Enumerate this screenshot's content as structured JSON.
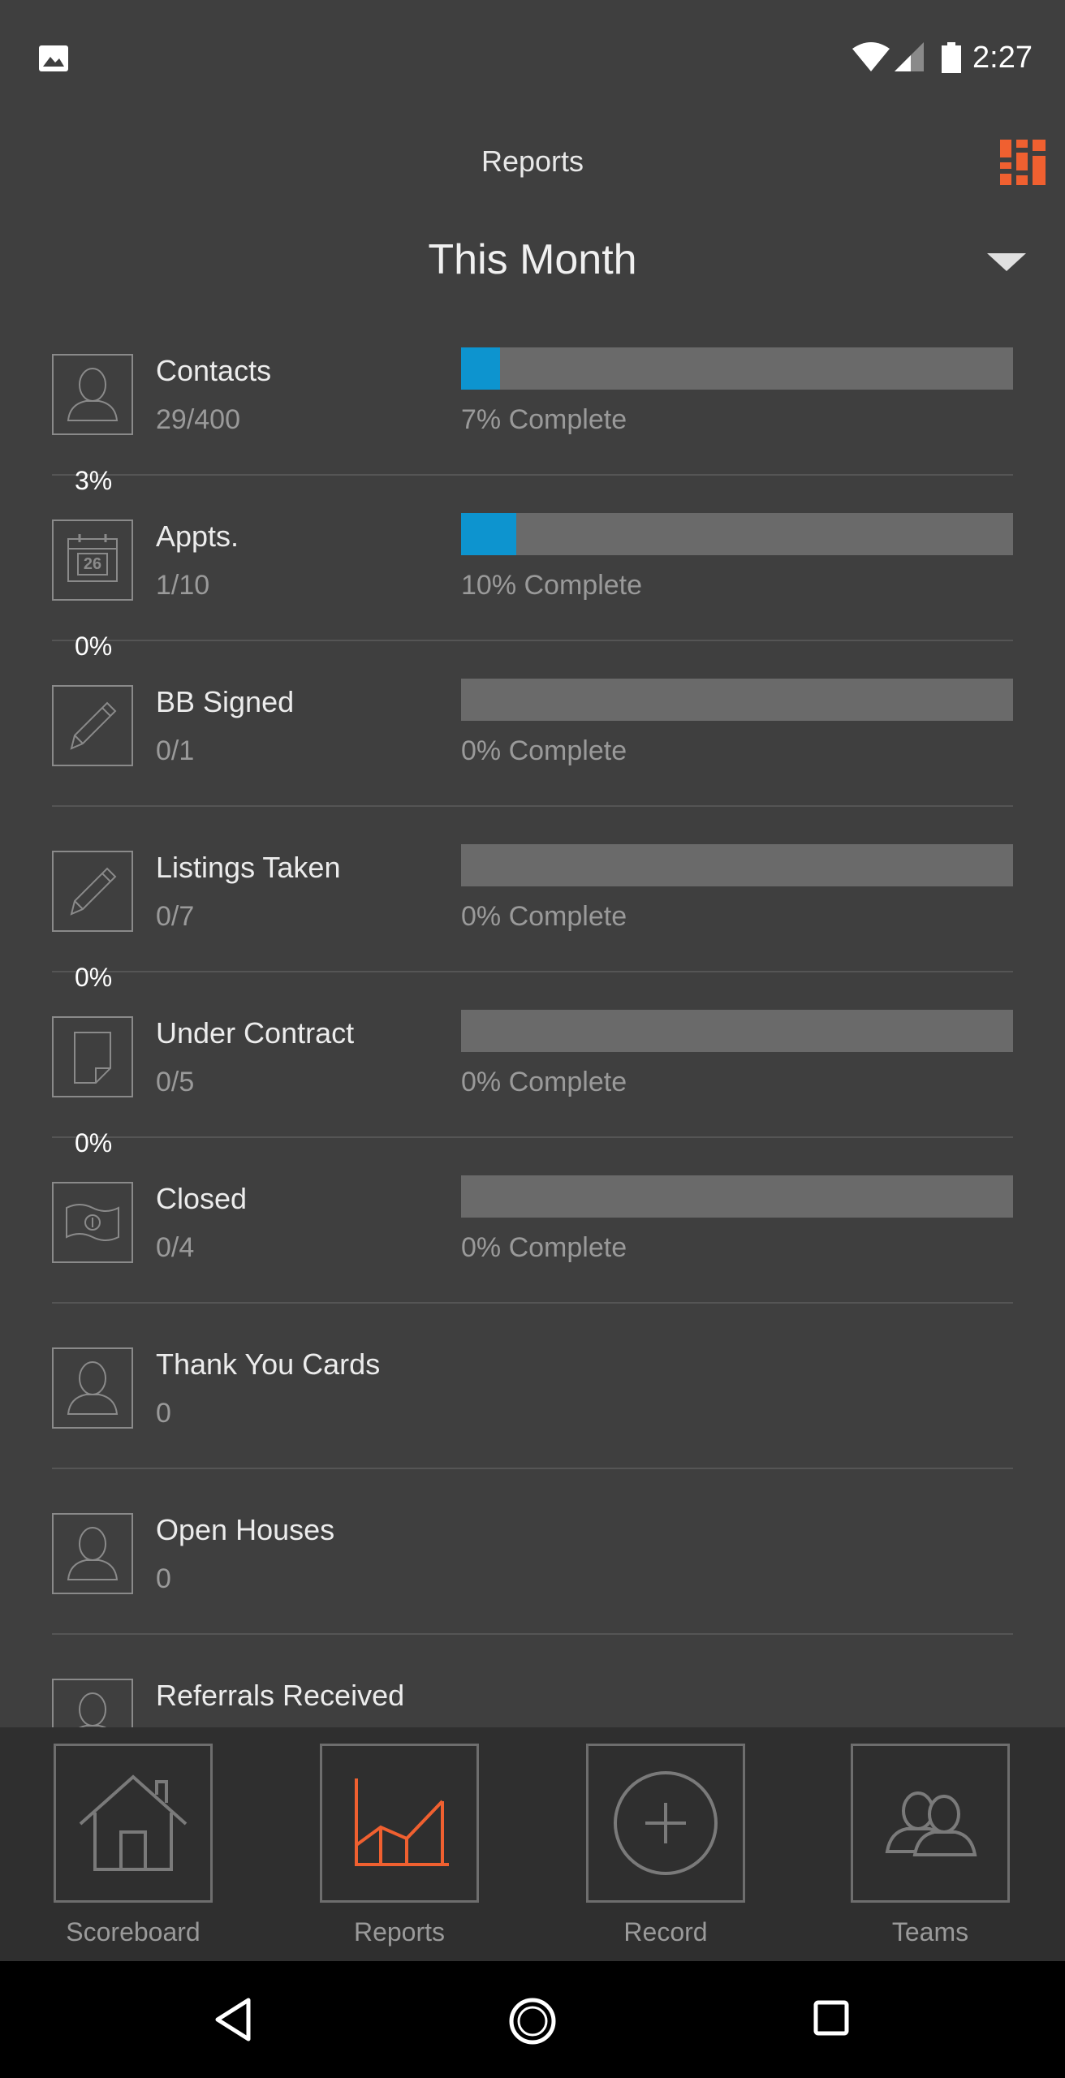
{
  "status_bar": {
    "time": "2:27"
  },
  "header": {
    "title": "Reports",
    "period": "This Month"
  },
  "metrics": [
    {
      "label": "Contacts",
      "value": "29/400",
      "progress": 0.07,
      "complete_text": "7% Complete",
      "icon": "person-icon"
    },
    {
      "badge": "3%",
      "label": "Appts.",
      "value": "1/10",
      "progress": 0.1,
      "complete_text": "10% Complete",
      "icon": "calendar-icon",
      "calendar_day": "26"
    },
    {
      "badge": "0%",
      "label": "BB Signed",
      "value": "0/1",
      "progress": 0,
      "complete_text": "0% Complete",
      "icon": "pencil-icon"
    },
    {
      "label": "Listings Taken",
      "value": "0/7",
      "progress": 0,
      "complete_text": "0% Complete",
      "icon": "pencil-icon"
    },
    {
      "badge": "0%",
      "label": "Under Contract",
      "value": "0/5",
      "progress": 0,
      "complete_text": "0% Complete",
      "icon": "document-icon"
    },
    {
      "badge": "0%",
      "label": "Closed",
      "value": "0/4",
      "progress": 0,
      "complete_text": "0% Complete",
      "icon": "money-icon"
    },
    {
      "label": "Thank You Cards",
      "value": "0",
      "icon": "person-icon"
    },
    {
      "label": "Open Houses",
      "value": "0",
      "icon": "person-icon"
    },
    {
      "label": "Referrals Received",
      "icon": "person-icon"
    }
  ],
  "bottom_nav": [
    {
      "label": "Scoreboard",
      "icon": "home-icon",
      "active": false
    },
    {
      "label": "Reports",
      "icon": "chart-icon",
      "active": true
    },
    {
      "label": "Record",
      "icon": "plus-circle-icon",
      "active": false
    },
    {
      "label": "Teams",
      "icon": "people-icon",
      "active": false
    }
  ],
  "colors": {
    "accent": "#f06030",
    "progress": "#0d94cf",
    "background": "#3f3f3f",
    "nav_background": "#2f2f2f"
  }
}
